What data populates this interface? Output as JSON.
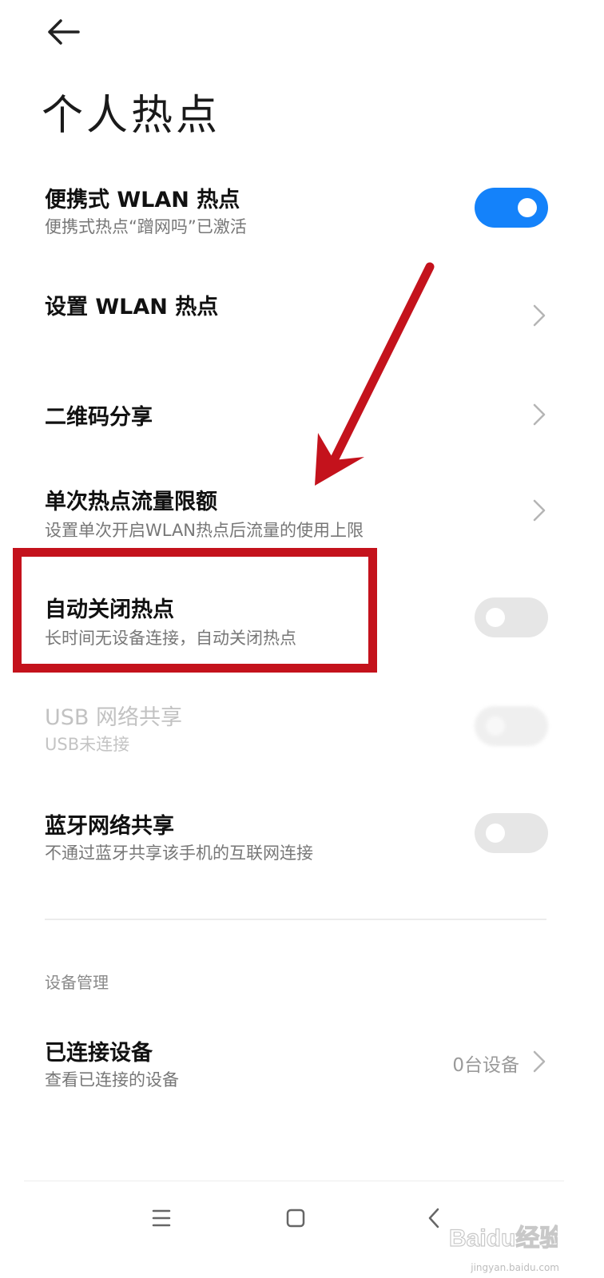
{
  "header": {
    "title": "个人热点"
  },
  "settings": {
    "portable": {
      "title": "便携式 WLAN 热点",
      "subtitle": "便携式热点“蹭网吗”已激活",
      "state": "on"
    },
    "setup": {
      "title": "设置 WLAN 热点"
    },
    "qr": {
      "title": "二维码分享"
    },
    "limit": {
      "title": "单次热点流量限额",
      "subtitle": "设置单次开启WLAN热点后流量的使用上限"
    },
    "autoclose": {
      "title": "自动关闭热点",
      "subtitle": "长时间无设备连接，自动关闭热点",
      "state": "off"
    },
    "usb": {
      "title": "USB 网络共享",
      "subtitle": "USB未连接",
      "state": "disabled"
    },
    "bluetooth": {
      "title": "蓝牙网络共享",
      "subtitle": "不通过蓝牙共享该手机的互联网连接",
      "state": "off"
    }
  },
  "device_section": {
    "label": "设备管理",
    "connected": {
      "title": "已连接设备",
      "subtitle": "查看已连接的设备",
      "value": "0台设备"
    }
  },
  "watermark": {
    "logo_text": "Baidu经验",
    "url_text": "jingyan.baidu.com"
  },
  "colors": {
    "accent": "#1482fa",
    "annotation": "#c4121c"
  },
  "icons": {
    "back": "arrow-left-icon",
    "chevron": "chevron-right-icon",
    "nav_menu": "menu-icon",
    "nav_home": "square-home-icon",
    "nav_back": "chevron-left-icon"
  }
}
